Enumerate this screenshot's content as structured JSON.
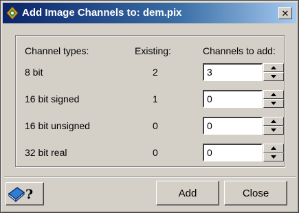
{
  "window": {
    "title": "Add Image Channels to: dem.pix",
    "close_label": "✕"
  },
  "headers": {
    "types": "Channel types:",
    "existing": "Existing:",
    "to_add": "Channels to add:"
  },
  "rows": [
    {
      "type": "8 bit",
      "existing": "2",
      "to_add": "3"
    },
    {
      "type": "16 bit signed",
      "existing": "1",
      "to_add": "0"
    },
    {
      "type": "16 bit unsigned",
      "existing": "0",
      "to_add": "0"
    },
    {
      "type": "32 bit real",
      "existing": "0",
      "to_add": "0"
    }
  ],
  "buttons": {
    "add": "Add",
    "close": "Close"
  },
  "icons": {
    "title": "app-icon",
    "help": "help-book-question-icon"
  }
}
